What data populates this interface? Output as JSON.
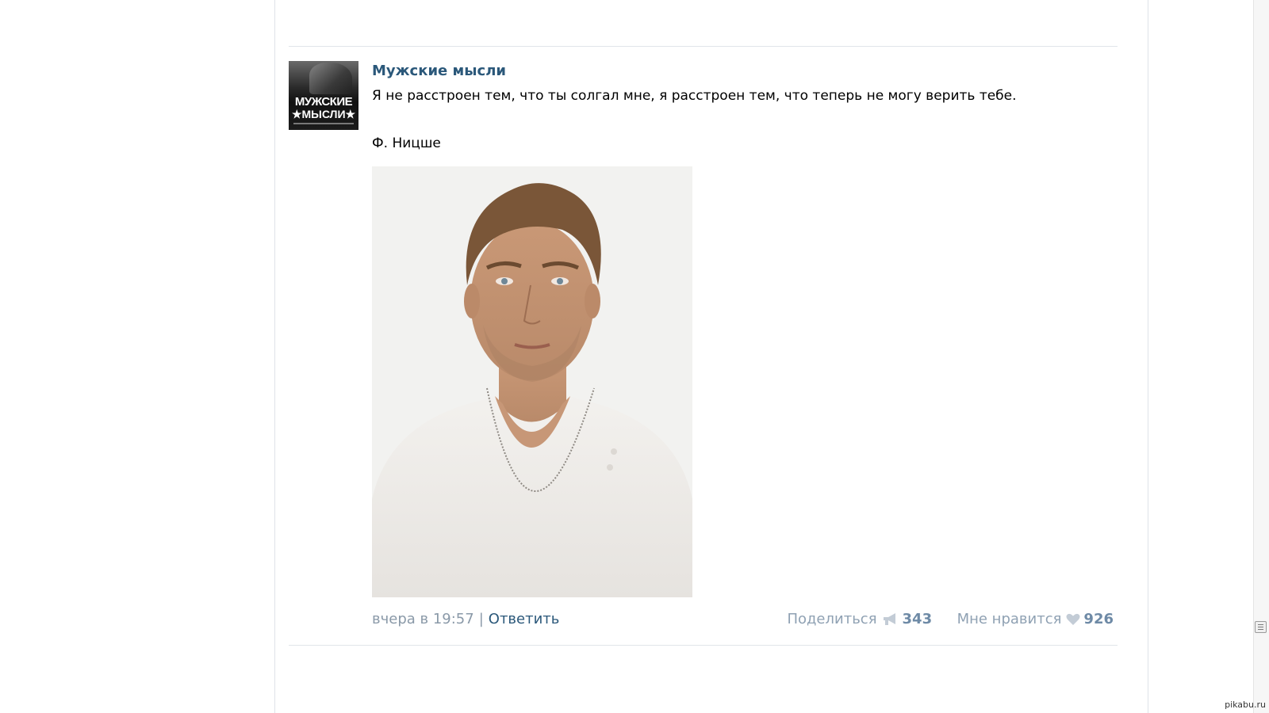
{
  "group": {
    "name": "Мужские мысли",
    "avatar_text_line1": "МУЖСКИЕ",
    "avatar_text_line2": "★МЫСЛИ★"
  },
  "post": {
    "text_line1": "Я не расстроен тем, что ты солгал мне, я расстроен тем, что теперь не могу верить тебе.",
    "text_line2": "Ф. Ницше",
    "date": "вчера в 19:57",
    "separator": "|",
    "reply_label": "Ответить",
    "share_label": "Поделиться",
    "share_icon": "megaphone-icon",
    "share_count": "343",
    "like_label": "Мне нравится",
    "like_icon": "heart-icon",
    "like_count": "926"
  },
  "watermark": "pikabu.ru",
  "colors": {
    "link": "#2b587a",
    "muted": "#8a99a8",
    "count": "#6e8aa6"
  }
}
